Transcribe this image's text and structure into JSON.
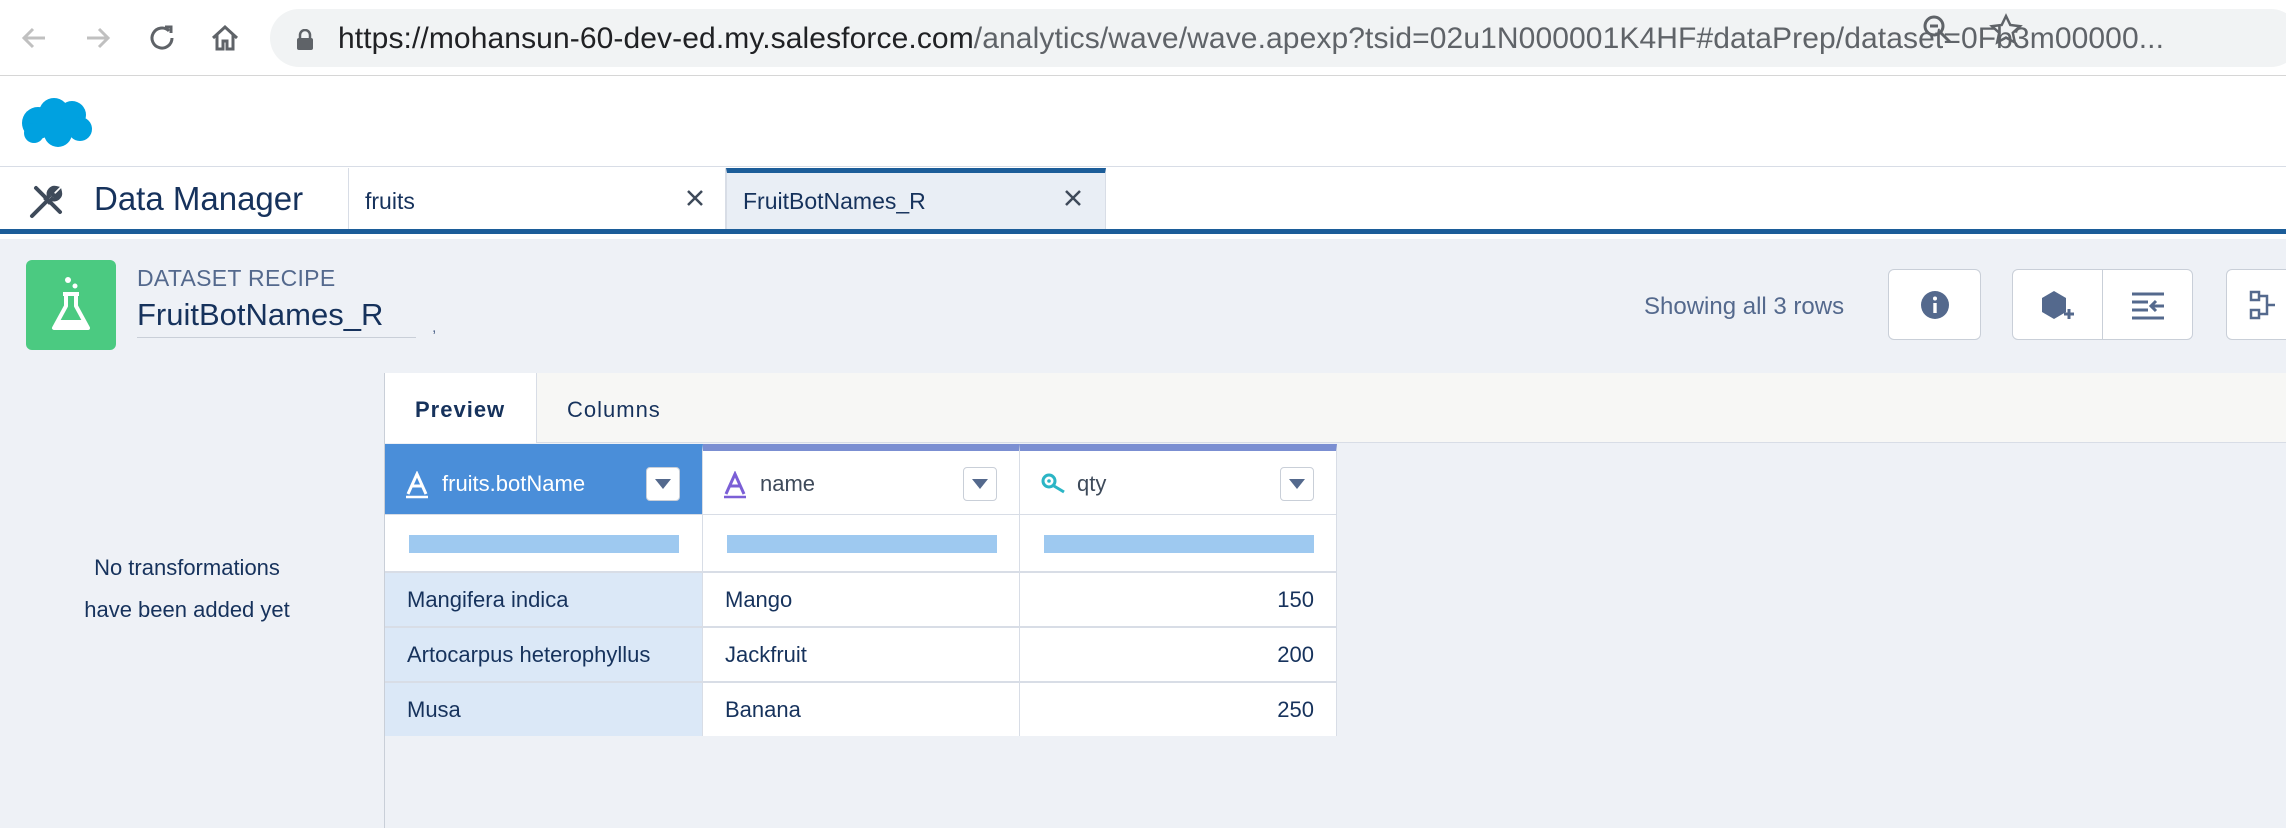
{
  "browser": {
    "url_domain": "https://mohansun-60-dev-ed.my.salesforce.com",
    "url_path": "/analytics/wave/wave.apexp?tsid=02u1N000001K4HF#dataPrep/dataset=0Fb3m00000..."
  },
  "app": {
    "title": "Data Manager",
    "tabs": [
      {
        "label": "fruits"
      },
      {
        "label": "FruitBotNames_R"
      }
    ]
  },
  "recipe": {
    "kicker": "DATASET RECIPE",
    "title": "FruitBotNames_R",
    "rows_status": "Showing all 3 rows"
  },
  "left_panel": {
    "note_line1": "No transformations",
    "note_line2": "have been added yet"
  },
  "preview_tabs": [
    {
      "label": "Preview"
    },
    {
      "label": "Columns"
    }
  ],
  "grid": {
    "columns": [
      {
        "label": "fruits.botName",
        "type_icon": "text-type-icon"
      },
      {
        "label": "name",
        "type_icon": "text-type-icon"
      },
      {
        "label": "qty",
        "type_icon": "measure-type-icon"
      }
    ],
    "rows": [
      [
        "Mangifera indica",
        "Mango",
        "150"
      ],
      [
        "Artocarpus heterophyllus",
        "Jackfruit",
        "200"
      ],
      [
        "Musa",
        "Banana",
        "250"
      ]
    ]
  },
  "colors": {
    "accent": "#1c5d99",
    "recipe_icon": "#4bca81",
    "selected_column": "#4a8ed9",
    "column_bar": "#7b8fd2",
    "distribution_bar": "#9ec9f0"
  }
}
